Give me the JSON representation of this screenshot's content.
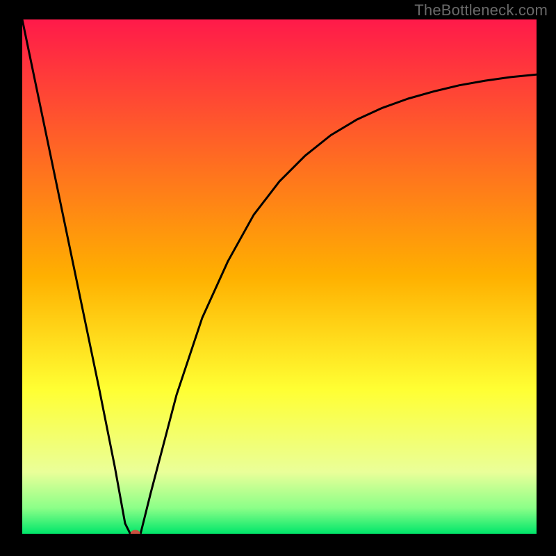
{
  "watermark": "TheBottleneck.com",
  "chart_data": {
    "type": "line",
    "title": "",
    "xlabel": "",
    "ylabel": "",
    "xlim": [
      0,
      100
    ],
    "ylim": [
      0,
      100
    ],
    "series": [
      {
        "name": "curve",
        "x": [
          0,
          5,
          10,
          15,
          18,
          20,
          21,
          23,
          25,
          30,
          35,
          40,
          45,
          50,
          55,
          60,
          65,
          70,
          75,
          80,
          85,
          90,
          95,
          100
        ],
        "values": [
          100,
          76,
          52,
          28,
          13,
          2,
          0,
          0,
          8,
          27,
          42,
          53,
          62,
          68.5,
          73.5,
          77.5,
          80.5,
          82.8,
          84.6,
          86,
          87.2,
          88.1,
          88.8,
          89.3
        ]
      }
    ],
    "marker": {
      "x": 22,
      "y": 0,
      "color": "#cc4f3f"
    },
    "gradient_stops": [
      {
        "pct": 0,
        "color": "#ff1a4a"
      },
      {
        "pct": 50,
        "color": "#ffb000"
      },
      {
        "pct": 72,
        "color": "#ffff33"
      },
      {
        "pct": 88,
        "color": "#eaff99"
      },
      {
        "pct": 95,
        "color": "#8bff88"
      },
      {
        "pct": 100,
        "color": "#00e66a"
      }
    ]
  }
}
